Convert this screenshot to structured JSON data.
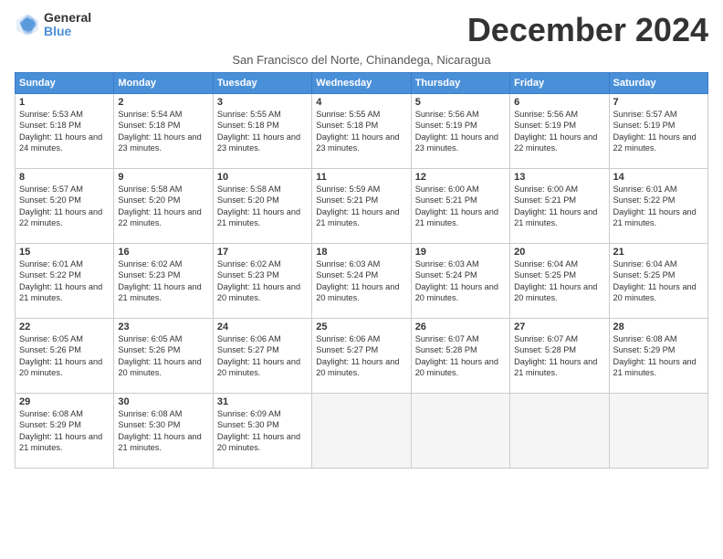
{
  "header": {
    "logo_general": "General",
    "logo_blue": "Blue",
    "month_title": "December 2024",
    "subtitle": "San Francisco del Norte, Chinandega, Nicaragua"
  },
  "days_of_week": [
    "Sunday",
    "Monday",
    "Tuesday",
    "Wednesday",
    "Thursday",
    "Friday",
    "Saturday"
  ],
  "weeks": [
    [
      {
        "day": "1",
        "sunrise": "5:53 AM",
        "sunset": "5:18 PM",
        "daylight": "11 hours and 24 minutes."
      },
      {
        "day": "2",
        "sunrise": "5:54 AM",
        "sunset": "5:18 PM",
        "daylight": "11 hours and 23 minutes."
      },
      {
        "day": "3",
        "sunrise": "5:55 AM",
        "sunset": "5:18 PM",
        "daylight": "11 hours and 23 minutes."
      },
      {
        "day": "4",
        "sunrise": "5:55 AM",
        "sunset": "5:18 PM",
        "daylight": "11 hours and 23 minutes."
      },
      {
        "day": "5",
        "sunrise": "5:56 AM",
        "sunset": "5:19 PM",
        "daylight": "11 hours and 23 minutes."
      },
      {
        "day": "6",
        "sunrise": "5:56 AM",
        "sunset": "5:19 PM",
        "daylight": "11 hours and 22 minutes."
      },
      {
        "day": "7",
        "sunrise": "5:57 AM",
        "sunset": "5:19 PM",
        "daylight": "11 hours and 22 minutes."
      }
    ],
    [
      {
        "day": "8",
        "sunrise": "5:57 AM",
        "sunset": "5:20 PM",
        "daylight": "11 hours and 22 minutes."
      },
      {
        "day": "9",
        "sunrise": "5:58 AM",
        "sunset": "5:20 PM",
        "daylight": "11 hours and 22 minutes."
      },
      {
        "day": "10",
        "sunrise": "5:58 AM",
        "sunset": "5:20 PM",
        "daylight": "11 hours and 21 minutes."
      },
      {
        "day": "11",
        "sunrise": "5:59 AM",
        "sunset": "5:21 PM",
        "daylight": "11 hours and 21 minutes."
      },
      {
        "day": "12",
        "sunrise": "6:00 AM",
        "sunset": "5:21 PM",
        "daylight": "11 hours and 21 minutes."
      },
      {
        "day": "13",
        "sunrise": "6:00 AM",
        "sunset": "5:21 PM",
        "daylight": "11 hours and 21 minutes."
      },
      {
        "day": "14",
        "sunrise": "6:01 AM",
        "sunset": "5:22 PM",
        "daylight": "11 hours and 21 minutes."
      }
    ],
    [
      {
        "day": "15",
        "sunrise": "6:01 AM",
        "sunset": "5:22 PM",
        "daylight": "11 hours and 21 minutes."
      },
      {
        "day": "16",
        "sunrise": "6:02 AM",
        "sunset": "5:23 PM",
        "daylight": "11 hours and 21 minutes."
      },
      {
        "day": "17",
        "sunrise": "6:02 AM",
        "sunset": "5:23 PM",
        "daylight": "11 hours and 20 minutes."
      },
      {
        "day": "18",
        "sunrise": "6:03 AM",
        "sunset": "5:24 PM",
        "daylight": "11 hours and 20 minutes."
      },
      {
        "day": "19",
        "sunrise": "6:03 AM",
        "sunset": "5:24 PM",
        "daylight": "11 hours and 20 minutes."
      },
      {
        "day": "20",
        "sunrise": "6:04 AM",
        "sunset": "5:25 PM",
        "daylight": "11 hours and 20 minutes."
      },
      {
        "day": "21",
        "sunrise": "6:04 AM",
        "sunset": "5:25 PM",
        "daylight": "11 hours and 20 minutes."
      }
    ],
    [
      {
        "day": "22",
        "sunrise": "6:05 AM",
        "sunset": "5:26 PM",
        "daylight": "11 hours and 20 minutes."
      },
      {
        "day": "23",
        "sunrise": "6:05 AM",
        "sunset": "5:26 PM",
        "daylight": "11 hours and 20 minutes."
      },
      {
        "day": "24",
        "sunrise": "6:06 AM",
        "sunset": "5:27 PM",
        "daylight": "11 hours and 20 minutes."
      },
      {
        "day": "25",
        "sunrise": "6:06 AM",
        "sunset": "5:27 PM",
        "daylight": "11 hours and 20 minutes."
      },
      {
        "day": "26",
        "sunrise": "6:07 AM",
        "sunset": "5:28 PM",
        "daylight": "11 hours and 20 minutes."
      },
      {
        "day": "27",
        "sunrise": "6:07 AM",
        "sunset": "5:28 PM",
        "daylight": "11 hours and 21 minutes."
      },
      {
        "day": "28",
        "sunrise": "6:08 AM",
        "sunset": "5:29 PM",
        "daylight": "11 hours and 21 minutes."
      }
    ],
    [
      {
        "day": "29",
        "sunrise": "6:08 AM",
        "sunset": "5:29 PM",
        "daylight": "11 hours and 21 minutes."
      },
      {
        "day": "30",
        "sunrise": "6:08 AM",
        "sunset": "5:30 PM",
        "daylight": "11 hours and 21 minutes."
      },
      {
        "day": "31",
        "sunrise": "6:09 AM",
        "sunset": "5:30 PM",
        "daylight": "11 hours and 20 minutes."
      },
      null,
      null,
      null,
      null
    ]
  ]
}
